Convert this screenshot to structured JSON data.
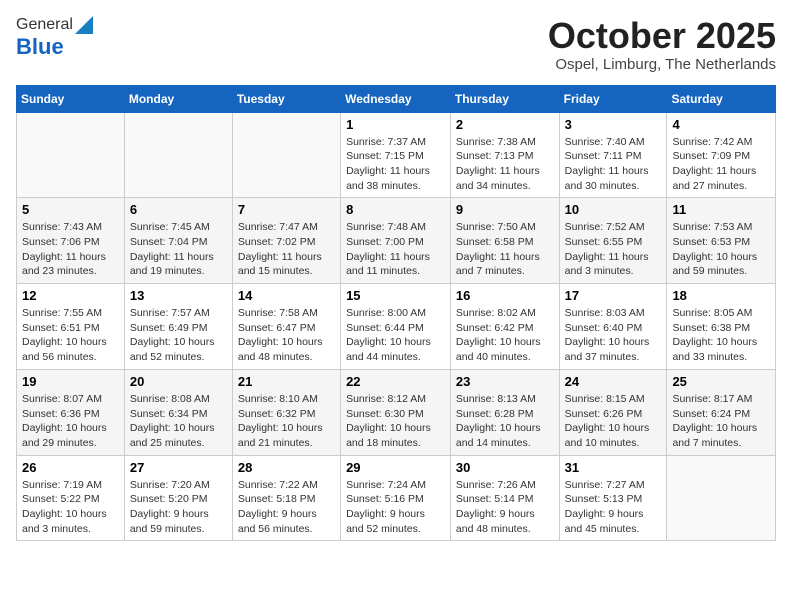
{
  "header": {
    "logo_general": "General",
    "logo_blue": "Blue",
    "month": "October 2025",
    "location": "Ospel, Limburg, The Netherlands"
  },
  "weekdays": [
    "Sunday",
    "Monday",
    "Tuesday",
    "Wednesday",
    "Thursday",
    "Friday",
    "Saturday"
  ],
  "weeks": [
    [
      {
        "day": "",
        "info": ""
      },
      {
        "day": "",
        "info": ""
      },
      {
        "day": "",
        "info": ""
      },
      {
        "day": "1",
        "info": "Sunrise: 7:37 AM\nSunset: 7:15 PM\nDaylight: 11 hours and 38 minutes."
      },
      {
        "day": "2",
        "info": "Sunrise: 7:38 AM\nSunset: 7:13 PM\nDaylight: 11 hours and 34 minutes."
      },
      {
        "day": "3",
        "info": "Sunrise: 7:40 AM\nSunset: 7:11 PM\nDaylight: 11 hours and 30 minutes."
      },
      {
        "day": "4",
        "info": "Sunrise: 7:42 AM\nSunset: 7:09 PM\nDaylight: 11 hours and 27 minutes."
      }
    ],
    [
      {
        "day": "5",
        "info": "Sunrise: 7:43 AM\nSunset: 7:06 PM\nDaylight: 11 hours and 23 minutes."
      },
      {
        "day": "6",
        "info": "Sunrise: 7:45 AM\nSunset: 7:04 PM\nDaylight: 11 hours and 19 minutes."
      },
      {
        "day": "7",
        "info": "Sunrise: 7:47 AM\nSunset: 7:02 PM\nDaylight: 11 hours and 15 minutes."
      },
      {
        "day": "8",
        "info": "Sunrise: 7:48 AM\nSunset: 7:00 PM\nDaylight: 11 hours and 11 minutes."
      },
      {
        "day": "9",
        "info": "Sunrise: 7:50 AM\nSunset: 6:58 PM\nDaylight: 11 hours and 7 minutes."
      },
      {
        "day": "10",
        "info": "Sunrise: 7:52 AM\nSunset: 6:55 PM\nDaylight: 11 hours and 3 minutes."
      },
      {
        "day": "11",
        "info": "Sunrise: 7:53 AM\nSunset: 6:53 PM\nDaylight: 10 hours and 59 minutes."
      }
    ],
    [
      {
        "day": "12",
        "info": "Sunrise: 7:55 AM\nSunset: 6:51 PM\nDaylight: 10 hours and 56 minutes."
      },
      {
        "day": "13",
        "info": "Sunrise: 7:57 AM\nSunset: 6:49 PM\nDaylight: 10 hours and 52 minutes."
      },
      {
        "day": "14",
        "info": "Sunrise: 7:58 AM\nSunset: 6:47 PM\nDaylight: 10 hours and 48 minutes."
      },
      {
        "day": "15",
        "info": "Sunrise: 8:00 AM\nSunset: 6:44 PM\nDaylight: 10 hours and 44 minutes."
      },
      {
        "day": "16",
        "info": "Sunrise: 8:02 AM\nSunset: 6:42 PM\nDaylight: 10 hours and 40 minutes."
      },
      {
        "day": "17",
        "info": "Sunrise: 8:03 AM\nSunset: 6:40 PM\nDaylight: 10 hours and 37 minutes."
      },
      {
        "day": "18",
        "info": "Sunrise: 8:05 AM\nSunset: 6:38 PM\nDaylight: 10 hours and 33 minutes."
      }
    ],
    [
      {
        "day": "19",
        "info": "Sunrise: 8:07 AM\nSunset: 6:36 PM\nDaylight: 10 hours and 29 minutes."
      },
      {
        "day": "20",
        "info": "Sunrise: 8:08 AM\nSunset: 6:34 PM\nDaylight: 10 hours and 25 minutes."
      },
      {
        "day": "21",
        "info": "Sunrise: 8:10 AM\nSunset: 6:32 PM\nDaylight: 10 hours and 21 minutes."
      },
      {
        "day": "22",
        "info": "Sunrise: 8:12 AM\nSunset: 6:30 PM\nDaylight: 10 hours and 18 minutes."
      },
      {
        "day": "23",
        "info": "Sunrise: 8:13 AM\nSunset: 6:28 PM\nDaylight: 10 hours and 14 minutes."
      },
      {
        "day": "24",
        "info": "Sunrise: 8:15 AM\nSunset: 6:26 PM\nDaylight: 10 hours and 10 minutes."
      },
      {
        "day": "25",
        "info": "Sunrise: 8:17 AM\nSunset: 6:24 PM\nDaylight: 10 hours and 7 minutes."
      }
    ],
    [
      {
        "day": "26",
        "info": "Sunrise: 7:19 AM\nSunset: 5:22 PM\nDaylight: 10 hours and 3 minutes."
      },
      {
        "day": "27",
        "info": "Sunrise: 7:20 AM\nSunset: 5:20 PM\nDaylight: 9 hours and 59 minutes."
      },
      {
        "day": "28",
        "info": "Sunrise: 7:22 AM\nSunset: 5:18 PM\nDaylight: 9 hours and 56 minutes."
      },
      {
        "day": "29",
        "info": "Sunrise: 7:24 AM\nSunset: 5:16 PM\nDaylight: 9 hours and 52 minutes."
      },
      {
        "day": "30",
        "info": "Sunrise: 7:26 AM\nSunset: 5:14 PM\nDaylight: 9 hours and 48 minutes."
      },
      {
        "day": "31",
        "info": "Sunrise: 7:27 AM\nSunset: 5:13 PM\nDaylight: 9 hours and 45 minutes."
      },
      {
        "day": "",
        "info": ""
      }
    ]
  ]
}
